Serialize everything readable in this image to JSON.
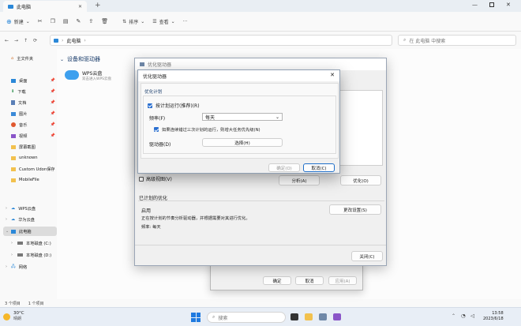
{
  "explorer": {
    "tab_title": "此电脑",
    "toolbar": {
      "new_label": "新建",
      "sort_label": "排序",
      "view_label": "查看"
    },
    "address": {
      "location": "此电脑",
      "search_placeholder": "在 此电脑 中搜索"
    },
    "sidebar": {
      "home": "主文件夹",
      "quick": [
        "桌面",
        "下载",
        "文档",
        "图片",
        "音乐",
        "视频",
        "屏幕截图",
        "unknown",
        "Custom Udon保存",
        "MobileFile"
      ],
      "wps": "WPS云盘",
      "huawei": "华为云盘",
      "thispc": "此电脑",
      "drive_c": "本地磁盘 (C:)",
      "drive_d": "本地磁盘 (D:)",
      "network": "网络"
    },
    "content": {
      "group_header": "设备和驱动器",
      "wps_name": "WPS云盘",
      "wps_sub": "双击进入WPS云盘"
    },
    "status": {
      "count": "3 个项目",
      "selected": "1 个项目"
    }
  },
  "optimize_window": {
    "title": "优化驱动器",
    "advanced_view": "高级视图(V)",
    "analyze_button": "分析(A)",
    "optimize_button": "优化(O)",
    "scheduled_header": "已计划的优化",
    "status_on": "启用",
    "status_desc": "正在按计划的节奏分析驱动器，并根据需要对其进行优化。",
    "frequency_line": "频率: 每天",
    "change_settings": "更改设置(S)",
    "close_button": "关闭(C)"
  },
  "ghost_dialog": {
    "ok": "确定",
    "cancel": "取消",
    "apply": "应用(A)"
  },
  "schedule_dialog": {
    "title": "优化驱动器",
    "section": "优化计划",
    "run_on_schedule": "按计划运行(推荐)(R)",
    "frequency_label": "频率(F)",
    "frequency_value": "每天",
    "increase_priority": "如果连续错过三次计划的运行，则增大任务优先级(N)",
    "drives_label": "驱动器(D)",
    "choose_button": "选择(H)",
    "ok_button": "确定(O)",
    "cancel_button": "取消(C)"
  },
  "taskbar": {
    "weather_temp": "30°C",
    "weather_desc": "晴朗",
    "search_placeholder": "搜索",
    "time": "13:58",
    "date": "2023/6/18"
  },
  "colors": {
    "accent": "#1f6fc9",
    "checkbox": "#2a6fd0"
  }
}
